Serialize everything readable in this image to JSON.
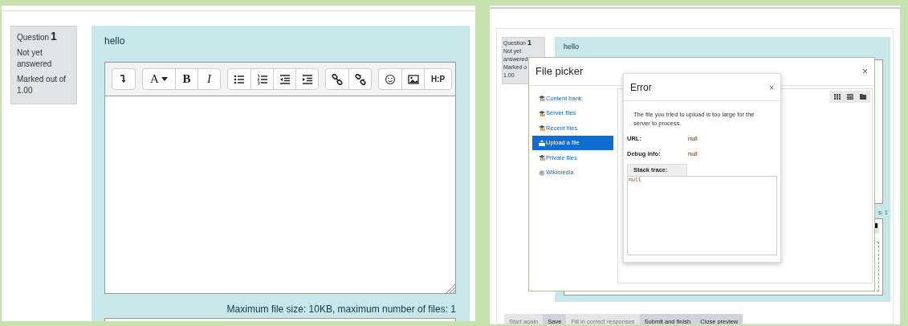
{
  "left": {
    "question": {
      "label": "Question",
      "number": "1",
      "lines": [
        "Not yet answered",
        "Marked out of 1.00"
      ]
    },
    "prompt": "hello",
    "toolbar": [
      [
        {
          "kind": "collapse"
        }
      ],
      [
        {
          "kind": "menu",
          "label": "A"
        },
        {
          "kind": "bold",
          "label": "B"
        },
        {
          "kind": "italic",
          "label": "I"
        }
      ],
      [
        {
          "kind": "bullets"
        },
        {
          "kind": "numbers"
        },
        {
          "kind": "outdent"
        },
        {
          "kind": "indent"
        }
      ],
      [
        {
          "kind": "link"
        },
        {
          "kind": "unlink"
        }
      ],
      [
        {
          "kind": "emoji"
        },
        {
          "kind": "image"
        },
        {
          "kind": "logo",
          "label": "H:P"
        }
      ]
    ],
    "limits": "Maximum file size: 10KB, maximum number of files: 1"
  },
  "right": {
    "question": {
      "label": "Question",
      "number": "1",
      "lines": [
        "Not yet",
        "answered",
        "Marked o",
        "1.00"
      ]
    },
    "prompt": "hello",
    "limits_tail": "s: 1",
    "buttons": [
      {
        "label": "Start again",
        "disabled": true
      },
      {
        "label": "Save",
        "disabled": false
      },
      {
        "label": "Fill in correct responses",
        "disabled": true
      },
      {
        "label": "Submit and finish",
        "disabled": false
      },
      {
        "label": "Close preview",
        "disabled": false
      }
    ],
    "file_picker": {
      "title": "File picker",
      "close": "×",
      "repositories": [
        {
          "label": "Content bank",
          "kind": "cap",
          "selected": false
        },
        {
          "label": "Server files",
          "kind": "cap",
          "selected": false
        },
        {
          "label": "Recent files",
          "kind": "cap",
          "selected": false
        },
        {
          "label": "Upload a file",
          "kind": "upload",
          "selected": true
        },
        {
          "label": "Private files",
          "kind": "cap",
          "selected": false
        },
        {
          "label": "Wikimedia",
          "kind": "globe",
          "selected": false
        }
      ]
    },
    "error": {
      "title": "Error",
      "close": "×",
      "message": "The file you tried to upload is too large for the server to process.",
      "fields": [
        {
          "label": "URL:",
          "value": "null"
        },
        {
          "label": "Debug info:",
          "value": "null"
        }
      ],
      "stack_label": "Stack trace:",
      "stack_value": "null"
    }
  }
}
